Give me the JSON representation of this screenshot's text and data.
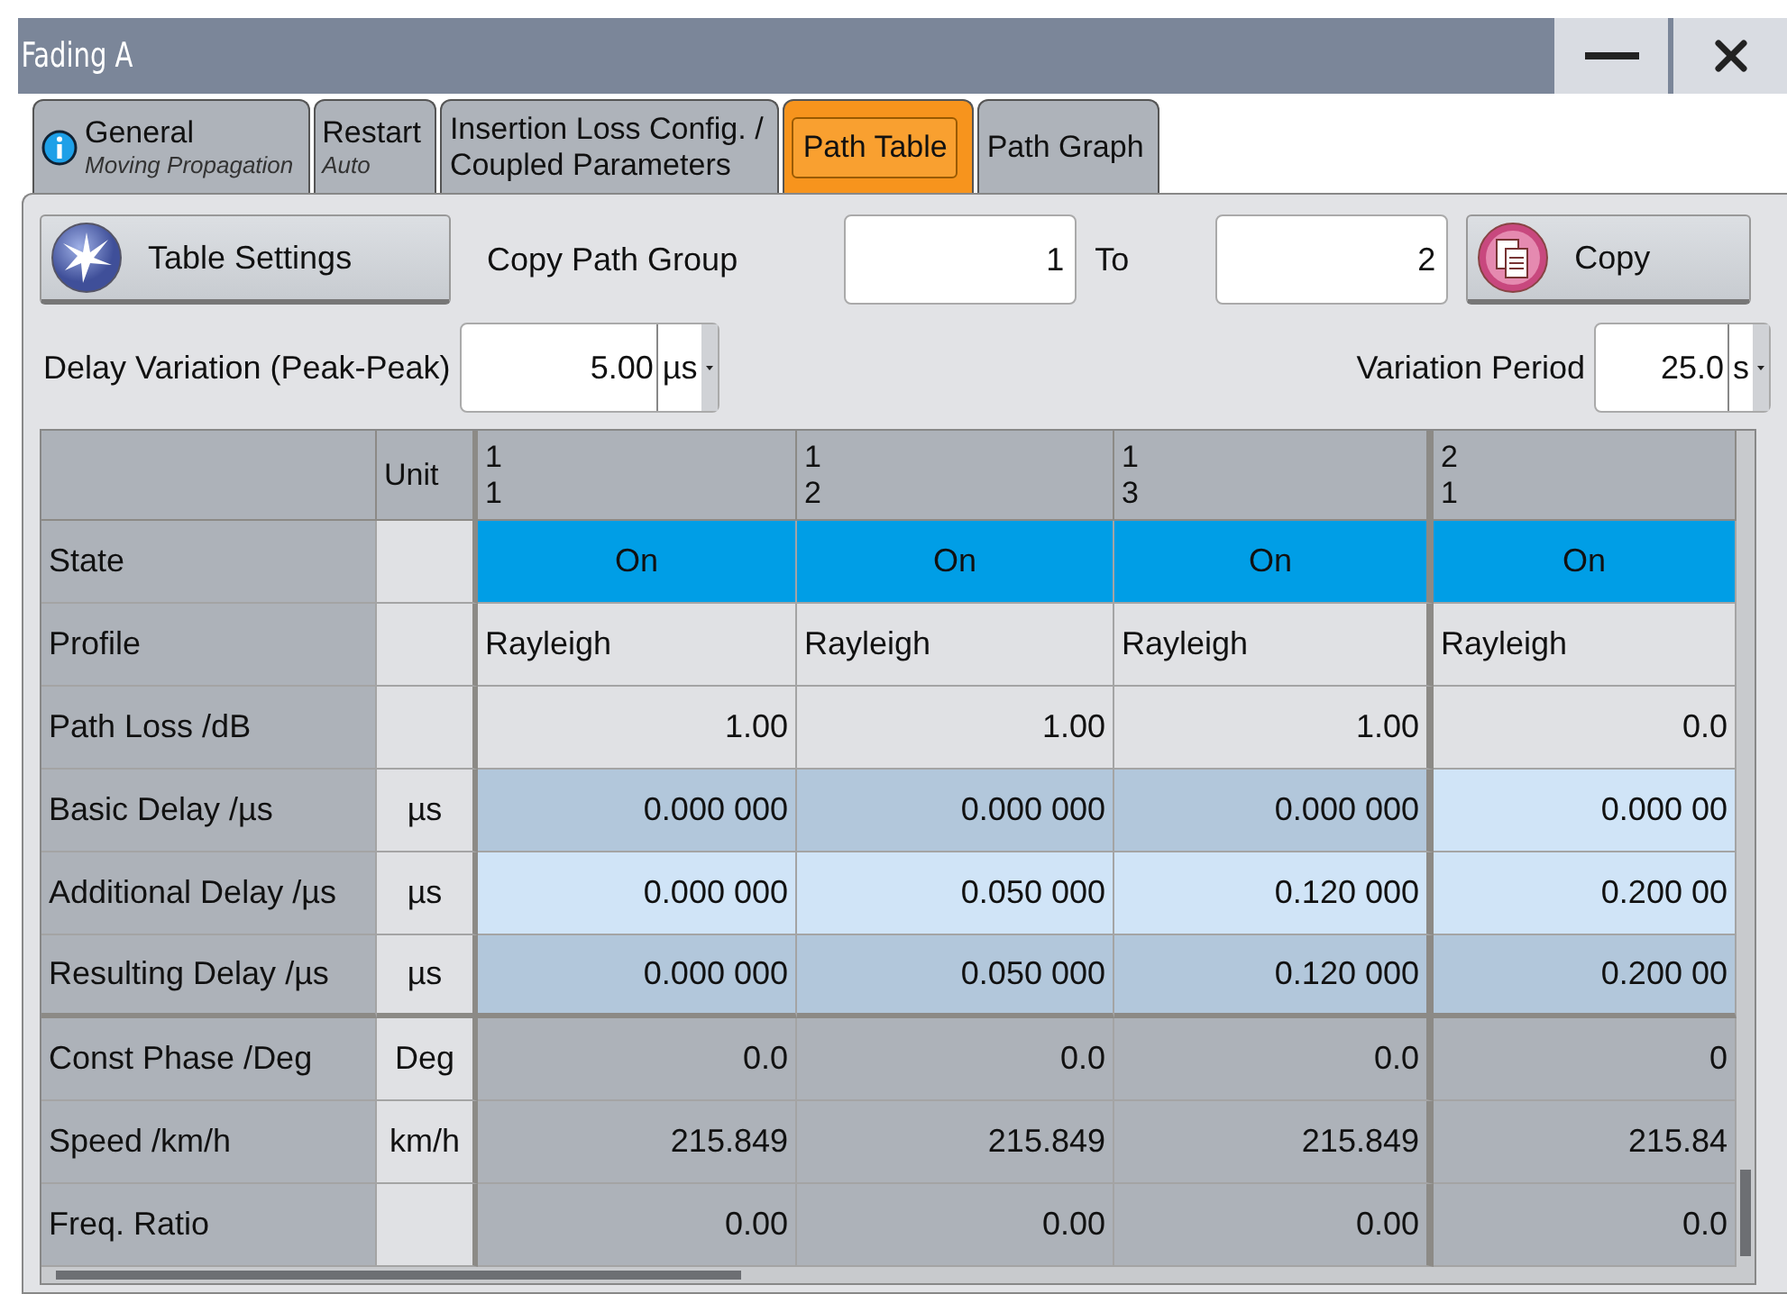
{
  "window": {
    "title": "Fading A"
  },
  "tabs": [
    {
      "label": "General",
      "sublabel": "Moving Propagation",
      "info": true,
      "selected": false
    },
    {
      "label": "Restart",
      "sublabel": "Auto",
      "info": false,
      "selected": false
    },
    {
      "label": "Insertion Loss Config. /\nCoupled Parameters",
      "info": false,
      "selected": false
    },
    {
      "label": "Path Table",
      "info": false,
      "selected": true
    },
    {
      "label": "Path Graph",
      "info": false,
      "selected": false
    }
  ],
  "toolbar": {
    "table_settings": "Table Settings",
    "copy_label": "Copy Path Group",
    "copy_from": "1",
    "to_label": "To",
    "copy_to": "2",
    "copy_button": "Copy"
  },
  "delay_variation": {
    "label": "Delay Variation (Peak-Peak)",
    "value": "5.00",
    "unit": "µs"
  },
  "variation_period": {
    "label": "Variation Period",
    "value": "25.0",
    "unit": "s"
  },
  "table": {
    "unit_heading": "Unit",
    "columns": [
      {
        "group": "1",
        "path": "1"
      },
      {
        "group": "1",
        "path": "2"
      },
      {
        "group": "1",
        "path": "3"
      },
      {
        "group": "2",
        "path": "1"
      }
    ],
    "rows": [
      {
        "label": "State",
        "unit": "",
        "cells": [
          {
            "text": "On",
            "kind": "state"
          },
          {
            "text": "On",
            "kind": "state"
          },
          {
            "text": "On",
            "kind": "state"
          },
          {
            "text": "On",
            "kind": "state"
          }
        ]
      },
      {
        "label": "Profile",
        "unit": "",
        "cells": [
          {
            "text": "Rayleigh",
            "kind": "text"
          },
          {
            "text": "Rayleigh",
            "kind": "text"
          },
          {
            "text": "Rayleigh",
            "kind": "text"
          },
          {
            "text": "Rayleigh",
            "kind": "text"
          }
        ]
      },
      {
        "label": "Path Loss /dB",
        "unit": "",
        "cells": [
          {
            "text": "1.00",
            "kind": "value"
          },
          {
            "text": "1.00",
            "kind": "value"
          },
          {
            "text": "1.00",
            "kind": "value"
          },
          {
            "text": "0.0",
            "kind": "value"
          }
        ]
      },
      {
        "label": "Basic Delay /µs",
        "unit": "µs",
        "cells": [
          {
            "text": "0.000 000",
            "kind": "dark"
          },
          {
            "text": "0.000 000",
            "kind": "dark"
          },
          {
            "text": "0.000 000",
            "kind": "dark"
          },
          {
            "text": "0.000 00",
            "kind": "light"
          }
        ]
      },
      {
        "label": "Additional Delay /µs",
        "unit": "µs",
        "cells": [
          {
            "text": "0.000 000",
            "kind": "light"
          },
          {
            "text": "0.050 000",
            "kind": "light"
          },
          {
            "text": "0.120 000",
            "kind": "light"
          },
          {
            "text": "0.200 00",
            "kind": "light"
          }
        ]
      },
      {
        "label": "Resulting Delay /µs",
        "unit": "µs",
        "cells": [
          {
            "text": "0.000 000",
            "kind": "dark"
          },
          {
            "text": "0.050 000",
            "kind": "dark"
          },
          {
            "text": "0.120 000",
            "kind": "dark"
          },
          {
            "text": "0.200 00",
            "kind": "dark"
          }
        ]
      },
      {
        "label": "Const Phase /Deg",
        "unit": "Deg",
        "cells": [
          {
            "text": "0.0",
            "kind": "readonly"
          },
          {
            "text": "0.0",
            "kind": "readonly"
          },
          {
            "text": "0.0",
            "kind": "readonly"
          },
          {
            "text": "0",
            "kind": "readonly"
          }
        ]
      },
      {
        "label": "Speed /km/h",
        "unit": "km/h",
        "cells": [
          {
            "text": "215.849",
            "kind": "readonly"
          },
          {
            "text": "215.849",
            "kind": "readonly"
          },
          {
            "text": "215.849",
            "kind": "readonly"
          },
          {
            "text": "215.84",
            "kind": "readonly"
          }
        ]
      },
      {
        "label": "Freq. Ratio",
        "unit": "",
        "cells": [
          {
            "text": "0.00",
            "kind": "readonly"
          },
          {
            "text": "0.00",
            "kind": "readonly"
          },
          {
            "text": "0.00",
            "kind": "readonly"
          },
          {
            "text": "0.0",
            "kind": "readonly"
          }
        ]
      }
    ]
  }
}
